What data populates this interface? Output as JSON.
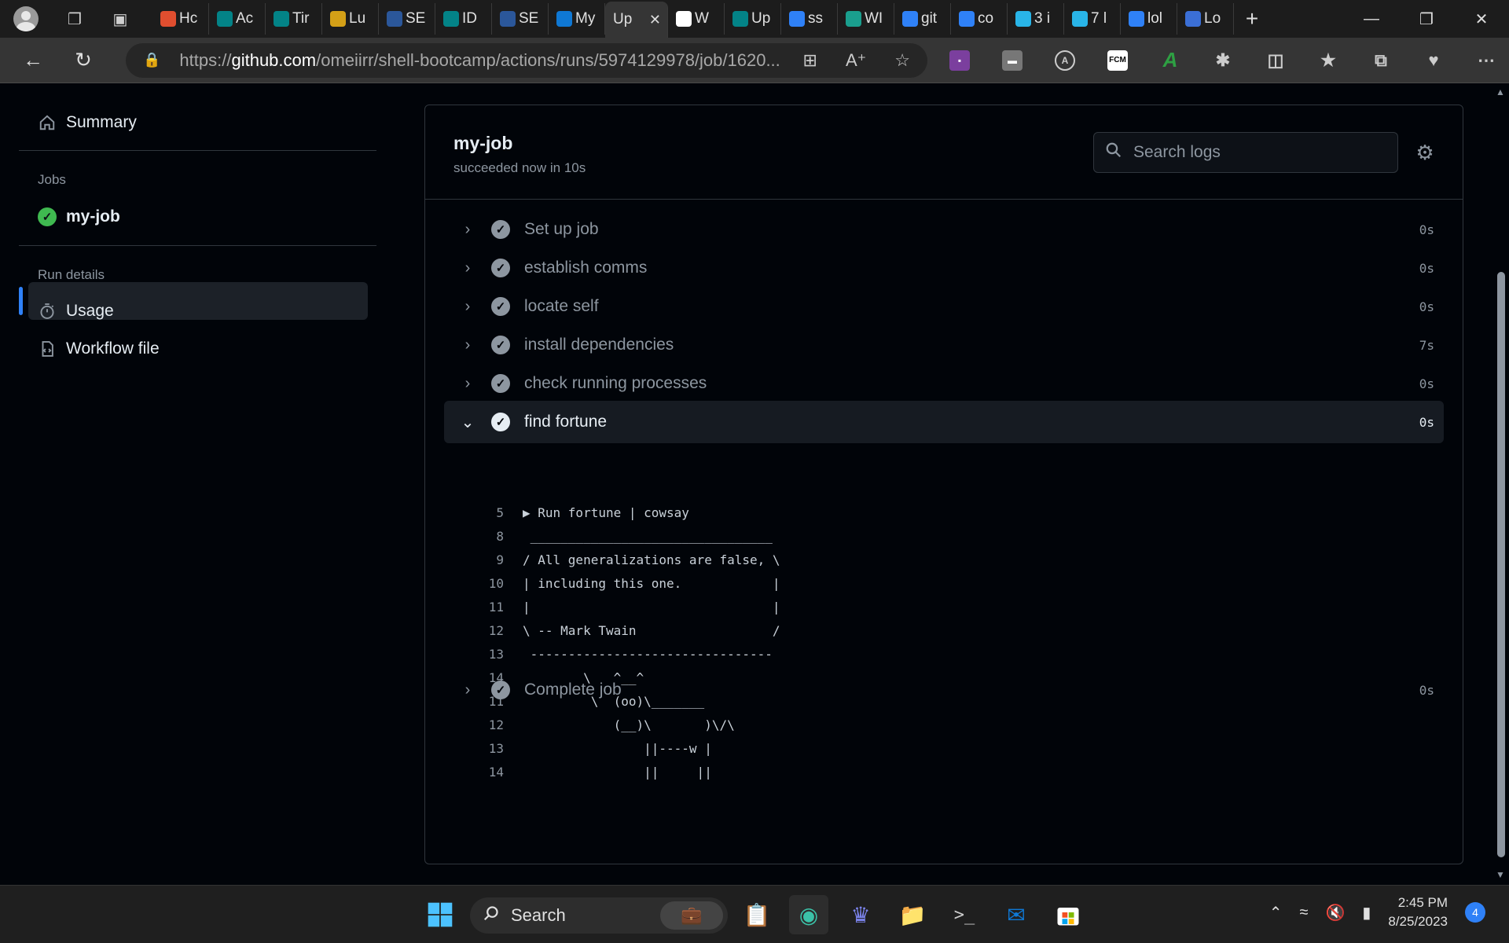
{
  "browser": {
    "tabs": [
      {
        "label": "Hc",
        "favicon": "shell-icon",
        "color": "#e04e2f"
      },
      {
        "label": "Ac",
        "favicon": "sharepoint-icon",
        "color": "#038387"
      },
      {
        "label": "Tir",
        "favicon": "sharepoint-icon",
        "color": "#038387"
      },
      {
        "label": "Lu",
        "favicon": "triangle-icon",
        "color": "#d4a017"
      },
      {
        "label": "SE",
        "favicon": "word-icon",
        "color": "#2b579a"
      },
      {
        "label": "ID",
        "favicon": "sharepoint-icon",
        "color": "#038387"
      },
      {
        "label": "SE",
        "favicon": "word-icon",
        "color": "#2b579a"
      },
      {
        "label": "My",
        "favicon": "onedrive-icon",
        "color": "#0f78d4"
      },
      {
        "label": "Up",
        "favicon": "",
        "color": "",
        "active": true
      },
      {
        "label": "W",
        "favicon": "github-icon",
        "color": "#ffffff"
      },
      {
        "label": "Up",
        "favicon": "sharepoint-icon",
        "color": "#038387"
      },
      {
        "label": "ss",
        "favicon": "search-icon",
        "color": "#2f81f7"
      },
      {
        "label": "WI",
        "favicon": "eye-icon",
        "color": "#1a9f8e"
      },
      {
        "label": "git",
        "favicon": "search-icon",
        "color": "#2f81f7"
      },
      {
        "label": "co",
        "favicon": "search-icon",
        "color": "#2f81f7"
      },
      {
        "label": "3 i",
        "favicon": "snowflake-icon",
        "color": "#29b5e8"
      },
      {
        "label": "7 l",
        "favicon": "snowflake-icon",
        "color": "#29b5e8"
      },
      {
        "label": "lol",
        "favicon": "search-icon",
        "color": "#2f81f7"
      },
      {
        "label": "Lo",
        "favicon": "shield-icon",
        "color": "#3b6fd6"
      }
    ],
    "url_scheme": "https://",
    "url_host": "github.com",
    "url_path": "/omeiirr/shell-bootcamp/actions/runs/5974129978/job/1620..."
  },
  "sidebar": {
    "summary_label": "Summary",
    "jobs_heading": "Jobs",
    "job_label": "my-job",
    "run_details_heading": "Run details",
    "usage_label": "Usage",
    "workflow_file_label": "Workflow file"
  },
  "job": {
    "title": "my-job",
    "subtitle": "succeeded now in 10s",
    "search_placeholder": "Search logs"
  },
  "steps": [
    {
      "name": "Set up job",
      "duration": "0s",
      "expanded": false
    },
    {
      "name": "establish comms",
      "duration": "0s",
      "expanded": false
    },
    {
      "name": "locate self",
      "duration": "0s",
      "expanded": false
    },
    {
      "name": "install dependencies",
      "duration": "7s",
      "expanded": false
    },
    {
      "name": "check running processes",
      "duration": "0s",
      "expanded": false
    },
    {
      "name": "find fortune",
      "duration": "0s",
      "expanded": true
    },
    {
      "name": "Complete job",
      "duration": "0s",
      "expanded": false
    }
  ],
  "log_lines": [
    {
      "num": "5",
      "text": "▶ Run fortune | cowsay"
    },
    {
      "num": "8",
      "text": " ________________________________"
    },
    {
      "num": "9",
      "text": "/ All generalizations are false, \\"
    },
    {
      "num": "10",
      "text": "| including this one.            |"
    },
    {
      "num": "11",
      "text": "|                                |"
    },
    {
      "num": "12",
      "text": "\\ -- Mark Twain                  /"
    },
    {
      "num": "13",
      "text": " --------------------------------"
    },
    {
      "num": "14",
      "text": "        \\   ^__^"
    },
    {
      "num": "11",
      "text": "         \\  (oo)\\_______"
    },
    {
      "num": "12",
      "text": "            (__)\\       )\\/\\"
    },
    {
      "num": "13",
      "text": "                ||----w |"
    },
    {
      "num": "14",
      "text": "                ||     ||"
    }
  ],
  "taskbar": {
    "search_label": "Search",
    "time": "2:45 PM",
    "date": "8/25/2023",
    "notification_count": "4"
  }
}
